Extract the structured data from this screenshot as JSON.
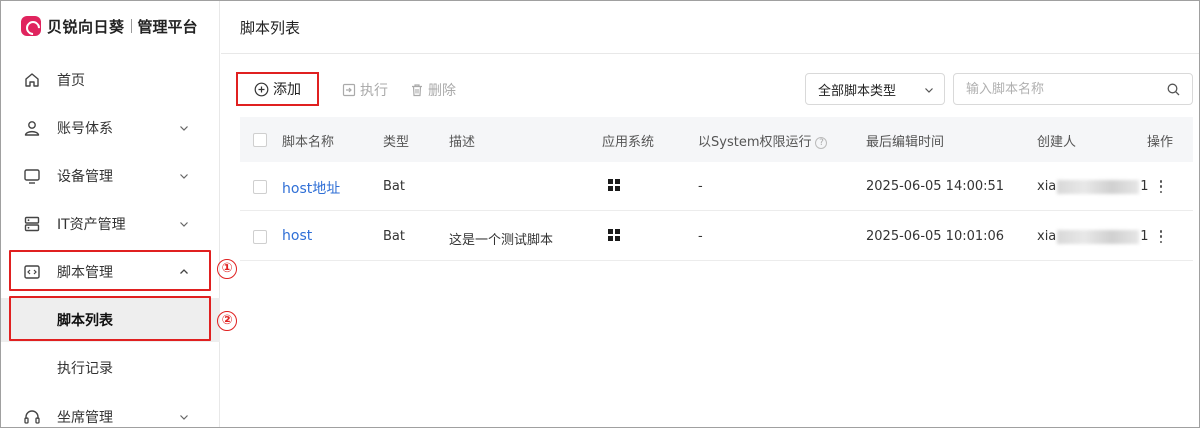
{
  "brand": {
    "name": "贝锐向日葵",
    "subtitle": "管理平台",
    "color": "#e0245e"
  },
  "sidebar": {
    "items": [
      {
        "label": "首页",
        "icon": "home-icon"
      },
      {
        "label": "账号体系",
        "icon": "user-icon"
      },
      {
        "label": "设备管理",
        "icon": "monitor-icon"
      },
      {
        "label": "IT资产管理",
        "icon": "server-icon"
      },
      {
        "label": "脚本管理",
        "icon": "code-icon",
        "expanded": true,
        "children": [
          {
            "label": "脚本列表",
            "active": true
          },
          {
            "label": "执行记录"
          }
        ]
      },
      {
        "label": "坐席管理",
        "icon": "headset-icon"
      }
    ]
  },
  "annotations": {
    "step1": "①",
    "step2": "②",
    "highlight_color": "#e02020"
  },
  "header": {
    "title": "脚本列表"
  },
  "toolbar": {
    "add_label": "添加",
    "execute_label": "执行",
    "delete_label": "删除",
    "type_select_value": "全部脚本类型",
    "search_placeholder": "输入脚本名称"
  },
  "table": {
    "columns": [
      "脚本名称",
      "类型",
      "描述",
      "应用系统",
      "以System权限运行",
      "最后编辑时间",
      "创建人",
      "操作"
    ],
    "rows": [
      {
        "name": "host地址",
        "type": "Bat",
        "description": "",
        "os": "windows",
        "run_as_system": "-",
        "last_edited": "2025-06-05 14:00:51",
        "creator_prefix": "xia",
        "creator_suffix": "1"
      },
      {
        "name": "host",
        "type": "Bat",
        "description": "这是一个测试脚本",
        "os": "windows",
        "run_as_system": "-",
        "last_edited": "2025-06-05 10:01:06",
        "creator_prefix": "xia",
        "creator_suffix": "1"
      }
    ]
  }
}
